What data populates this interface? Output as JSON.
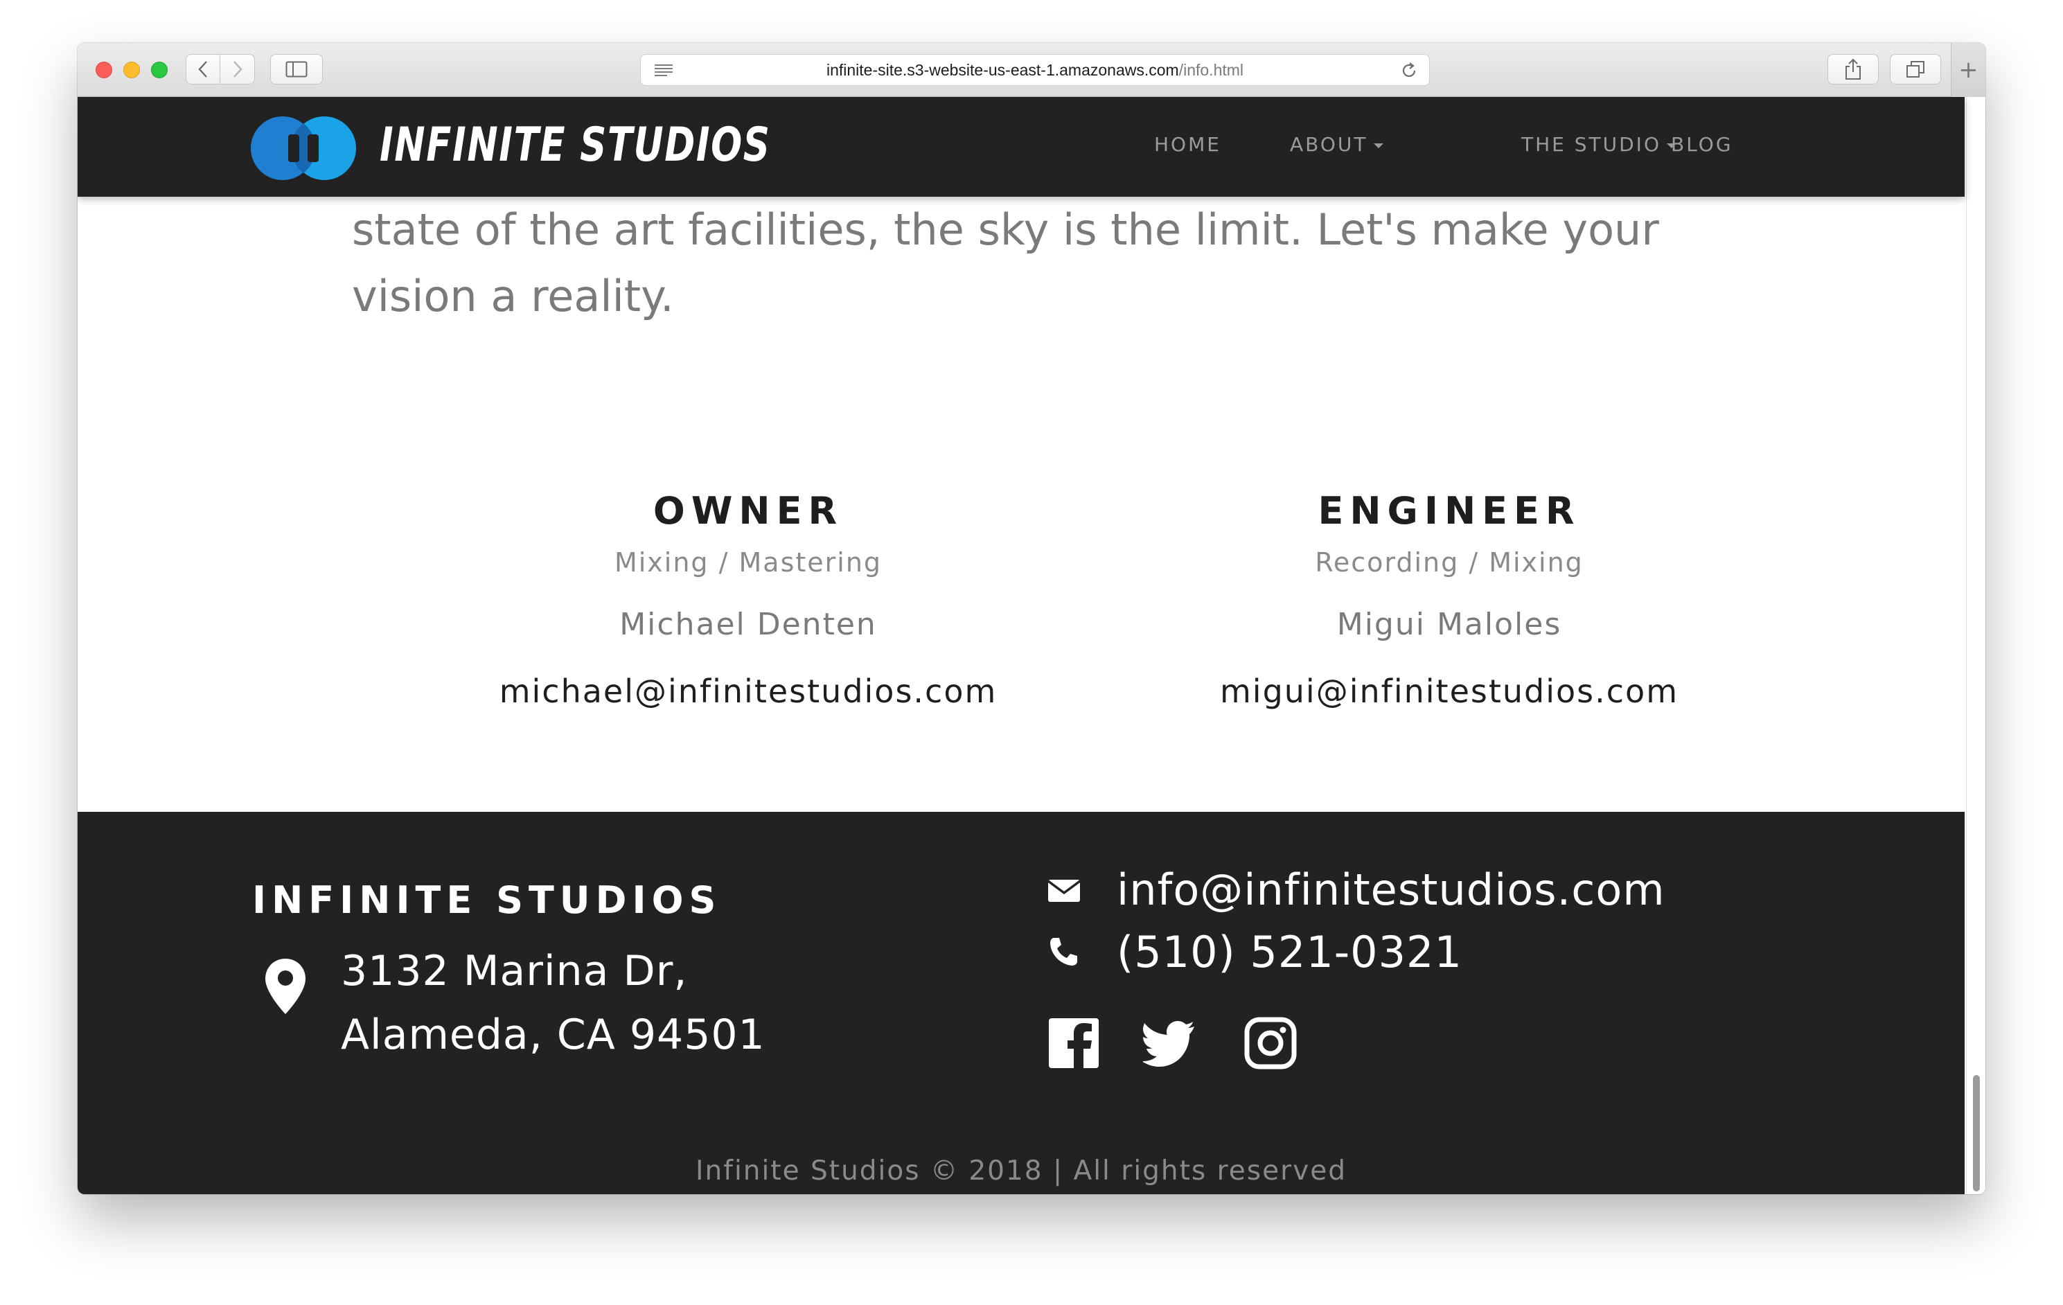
{
  "browser": {
    "url_host": "infinite-site.s3-website-us-east-1.amazonaws.com",
    "url_path": "/info.html"
  },
  "header": {
    "logo_text": "INFINITE STUDIOS",
    "nav": {
      "home": "HOME",
      "about": "ABOUT",
      "studio": "THE STUDIO",
      "blog": "BLOG"
    }
  },
  "intro": {
    "line1": "state of the art facilities, the sky is the limit. Let's make your",
    "line2": "vision a reality."
  },
  "staff": [
    {
      "role": "OWNER",
      "skills": "Mixing / Mastering",
      "name": "Michael Denten",
      "email": "michael@infinitestudios.com"
    },
    {
      "role": "ENGINEER",
      "skills": "Recording / Mixing",
      "name": "Migui Maloles",
      "email": "migui@infinitestudios.com"
    }
  ],
  "footer": {
    "title": "INFINITE STUDIOS",
    "address_line1": "3132 Marina Dr,",
    "address_line2": "Alameda, CA 94501",
    "email": "info@infinitestudios.com",
    "phone": "(510) 521-0321",
    "social": [
      "facebook-icon",
      "twitter-icon",
      "instagram-icon"
    ],
    "copyright": "Infinite Studios © 2018 | All rights reserved"
  },
  "colors": {
    "header_bg": "#222222",
    "footer_bg": "#222222",
    "logo_blue": "#1f7fd1",
    "logo_light_blue": "#1aa3e6"
  }
}
